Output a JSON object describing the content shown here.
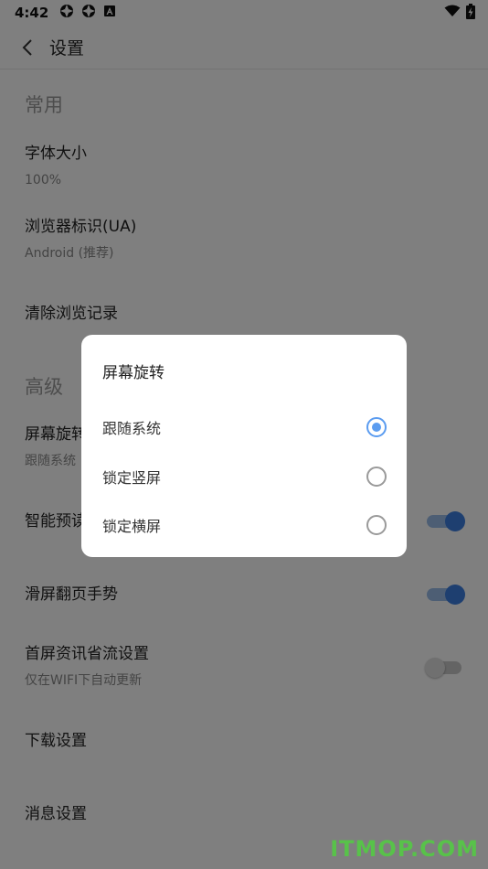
{
  "status_bar": {
    "time": "4:42"
  },
  "app_bar": {
    "title": "设置"
  },
  "sections": {
    "common": {
      "header": "常用",
      "font_size": {
        "title": "字体大小",
        "value": "100%"
      },
      "user_agent": {
        "title": "浏览器标识(UA)",
        "value": "Android (推荐)"
      },
      "clear_history": {
        "title": "清除浏览记录"
      }
    },
    "advanced": {
      "header": "高级",
      "screen_rotation": {
        "title": "屏幕旋转",
        "value": "跟随系统"
      },
      "smart_preread": {
        "title": "智能预读",
        "enabled": true
      },
      "swipe_gesture": {
        "title": "滑屏翻页手势",
        "enabled": true
      },
      "home_data_saving": {
        "title": "首屏资讯省流设置",
        "subtitle": "仅在WIFI下自动更新",
        "enabled": false
      },
      "download_settings": {
        "title": "下载设置"
      },
      "message_settings": {
        "title": "消息设置"
      }
    }
  },
  "dialog": {
    "title": "屏幕旋转",
    "options": [
      {
        "label": "跟随系统",
        "selected": true
      },
      {
        "label": "锁定竖屏",
        "selected": false
      },
      {
        "label": "锁定横屏",
        "selected": false
      }
    ]
  },
  "watermark": "ITMOP.COM",
  "colors": {
    "accent": "#3c7fe0",
    "radio_checked": "#5b9cf0",
    "watermark": "#58c24a"
  }
}
